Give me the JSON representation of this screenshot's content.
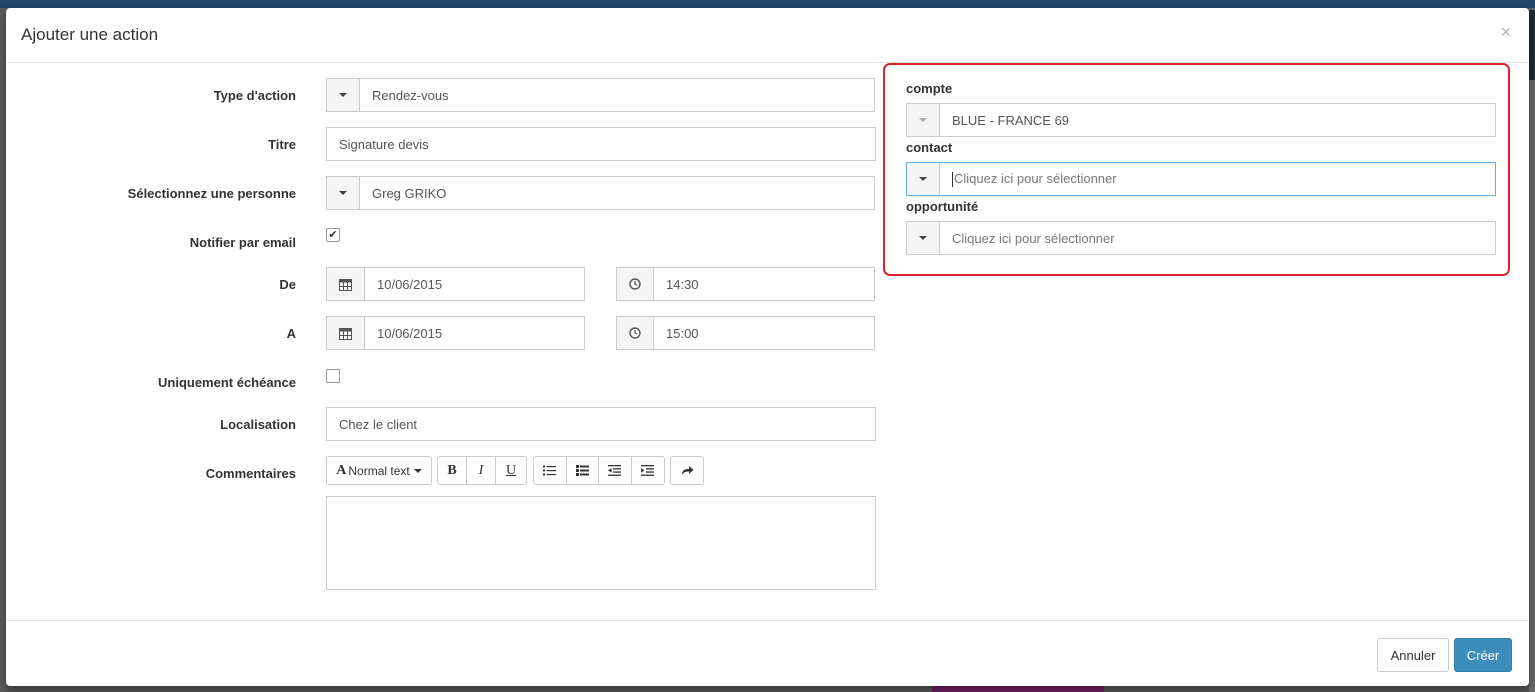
{
  "modal": {
    "title": "Ajouter une action",
    "close_label": "×"
  },
  "form": {
    "type_label": "Type d'action",
    "type_value": "Rendez-vous",
    "titre_label": "Titre",
    "titre_value": "Signature devis",
    "personne_label": "Sélectionnez une personne",
    "personne_value": "Greg GRIKO",
    "notifier_label": "Notifier par email",
    "notifier_checked": true,
    "notifier_mark": "✔",
    "de_label": "De",
    "de_date": "10/06/2015",
    "de_time": "14:30",
    "a_label": "A",
    "a_date": "10/06/2015",
    "a_time": "15:00",
    "echeance_label": "Uniquement échéance",
    "echeance_checked": false,
    "localisation_label": "Localisation",
    "localisation_value": "Chez le client",
    "commentaires_label": "Commentaires"
  },
  "editor_toolbar": {
    "font_icon": "A",
    "style_label": "Normal text",
    "bold": "B",
    "italic": "I",
    "underline": "U"
  },
  "relations": {
    "compte_label": "compte",
    "compte_value": "BLUE - FRANCE 69",
    "contact_label": "contact",
    "contact_placeholder": "Cliquez ici pour sélectionner",
    "opportunite_label": "opportunité",
    "opportunite_placeholder": "Cliquez ici pour sélectionner"
  },
  "footer": {
    "cancel_label": "Annuler",
    "create_label": "Créer"
  },
  "colors": {
    "primary": "#3c8dbc",
    "highlight": "#d9232d"
  }
}
